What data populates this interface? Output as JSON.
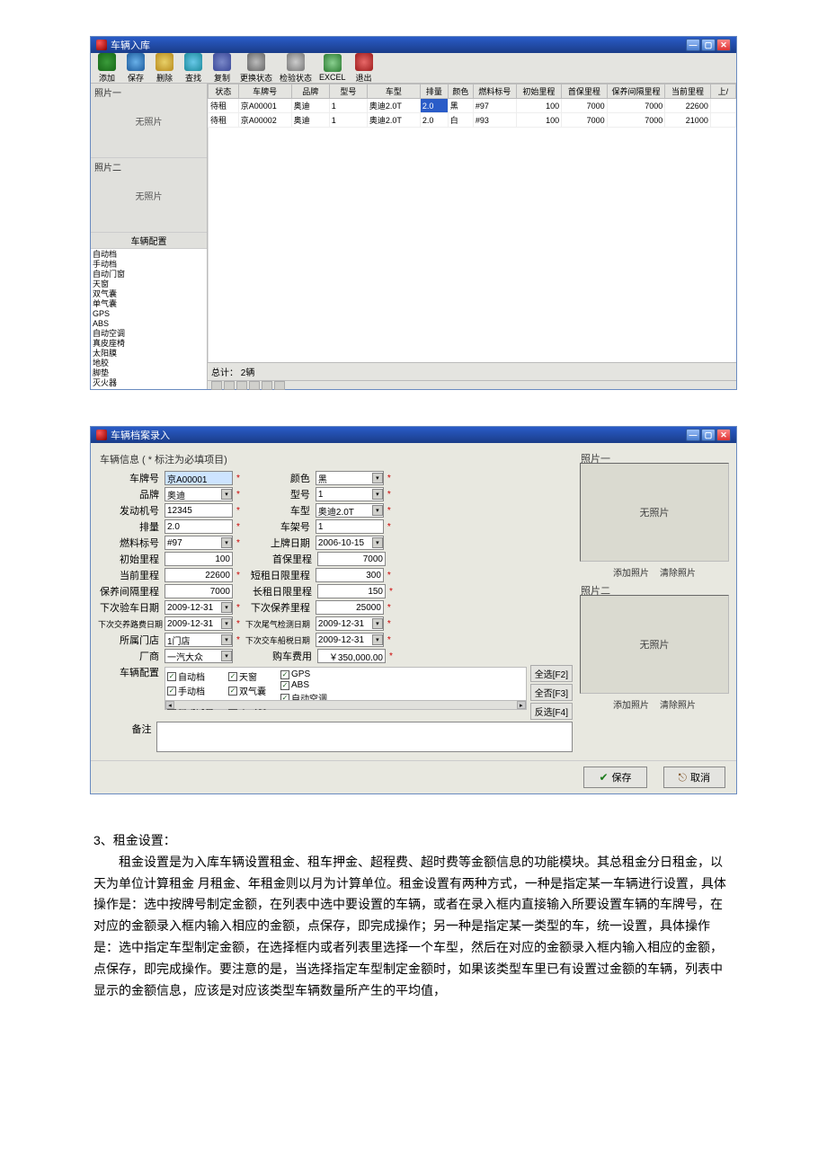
{
  "win1": {
    "title": "车辆入库",
    "toolbar": [
      {
        "label": "添加",
        "icon": "ico-add"
      },
      {
        "label": "保存",
        "icon": "ico-save"
      },
      {
        "label": "删除",
        "icon": "ico-del"
      },
      {
        "label": "查找",
        "icon": "ico-find"
      },
      {
        "label": "复制",
        "icon": "ico-copy"
      },
      {
        "label": "更换状态",
        "icon": "ico-chg"
      },
      {
        "label": "检验状态",
        "icon": "ico-check"
      },
      {
        "label": "EXCEL",
        "icon": "ico-excel"
      },
      {
        "label": "退出",
        "icon": "ico-exit"
      }
    ],
    "photo1_label": "照片一",
    "photo2_label": "照片二",
    "no_photo": "无照片",
    "config_head": "车辆配置",
    "config_items": [
      "自动档",
      "手动档",
      "自动门窗",
      "天窗",
      "双气囊",
      "单气囊",
      "GPS",
      "ABS",
      "自动空调",
      "真皮座椅",
      "太阳膜",
      "地胶",
      "脚垫",
      "灭火器"
    ],
    "grid": {
      "cols": [
        "状态",
        "车牌号",
        "品牌",
        "型号",
        "车型",
        "排量",
        "颜色",
        "燃料标号",
        "初始里程",
        "首保里程",
        "保养间隔里程",
        "当前里程",
        "上/"
      ],
      "rows": [
        {
          "状态": "待租",
          "车牌号": "京A00001",
          "品牌": "奥迪",
          "型号": "1",
          "车型": "奥迪2.0T",
          "排量": "2.0",
          "颜色": "黑",
          "燃料标号": "#97",
          "初始里程": "100",
          "首保里程": "7000",
          "保养间隔里程": "7000",
          "当前里程": "22600",
          "sel_col": "排量"
        },
        {
          "状态": "待租",
          "车牌号": "京A00002",
          "品牌": "奥迪",
          "型号": "1",
          "车型": "奥迪2.0T",
          "排量": "2.0",
          "颜色": "白",
          "燃料标号": "#93",
          "初始里程": "100",
          "首保里程": "7000",
          "保养间隔里程": "7000",
          "当前里程": "21000"
        }
      ]
    },
    "status_total": "总计：  2辆"
  },
  "win2": {
    "title": "车辆档案录入",
    "form_head": "车辆信息 ( * 标注为必填项目)",
    "labels": {
      "plate": "车牌号",
      "brand": "品牌",
      "engine": "发动机号",
      "disp": "排量",
      "fuel": "燃料标号",
      "initmi": "初始里程",
      "curmi": "当前里程",
      "maintmi": "保养间隔里程",
      "nextchk": "下次验车日期",
      "nextroad": "下次交养路费日期",
      "store": "所属门店",
      "maker": "厂商",
      "cfg": "车辆配置",
      "remark": "备注",
      "color": "颜色",
      "model": "型号",
      "type": "车型",
      "chassis": "车架号",
      "platedate": "上牌日期",
      "firstmaint": "首保里程",
      "shortmi": "短租日限里程",
      "longmi": "长租日限里程",
      "nextmaintmi": "下次保养里程",
      "nextemis": "下次尾气检测日期",
      "nexttax": "下次交车船税日期",
      "buycost": "购车费用"
    },
    "values": {
      "plate": "京A00001",
      "brand": "奥迪",
      "engine": "12345",
      "disp": "2.0",
      "fuel": "#97",
      "initmi": "100",
      "curmi": "22600",
      "maintmi": "7000",
      "nextchk": "2009-12-31",
      "nextroad": "2009-12-31",
      "store": "1门店",
      "maker": "一汽大众",
      "color": "黑",
      "model": "1",
      "type": "奥迪2.0T",
      "chassis": "1",
      "platedate": "2006-10-15",
      "firstmaint": "7000",
      "shortmi": "300",
      "longmi": "150",
      "nextmaintmi": "25000",
      "nextemis": "2009-12-31",
      "nexttax": "2009-12-31",
      "buycost": "￥350,000.00"
    },
    "cfg_opts": {
      "col1": [
        "自动档",
        "手动档",
        "自动门窗"
      ],
      "col2": [
        "天窗",
        "双气囊",
        "单气囊"
      ],
      "col3": [
        "GPS",
        "ABS",
        "自动空调"
      ]
    },
    "sel_btns": {
      "all": "全选[F2]",
      "none": "全否[F3]",
      "inv": "反选[F4]"
    },
    "photo1": "照片一",
    "photo2": "照片二",
    "no_photo": "无照片",
    "add_photo": "添加照片",
    "clear_photo": "清除照片",
    "save": "保存",
    "cancel": "取消"
  },
  "doc": {
    "heading": "3、租金设置：",
    "body": "租金设置是为入库车辆设置租金、租车押金、超程费、超时费等金额信息的功能模块。其总租金分日租金，以天为单位计算租金 月租金、年租金则以月为计算单位。租金设置有两种方式，一种是指定某一车辆进行设置，具体操作是：选中按牌号制定金额，在列表中选中要设置的车辆，或者在录入框内直接输入所要设置车辆的车牌号，在对应的金额录入框内输入相应的金额，点保存，即完成操作；另一种是指定某一类型的车，统一设置，具体操作是：选中指定车型制定金额，在选择框内或者列表里选择一个车型，然后在对应的金额录入框内输入相应的金额，点保存，即完成操作。要注意的是，当选择指定车型制定金额时，如果该类型车里已有设置过金额的车辆，列表中显示的金额信息，应该是对应该类型车辆数量所产生的平均值，"
  }
}
